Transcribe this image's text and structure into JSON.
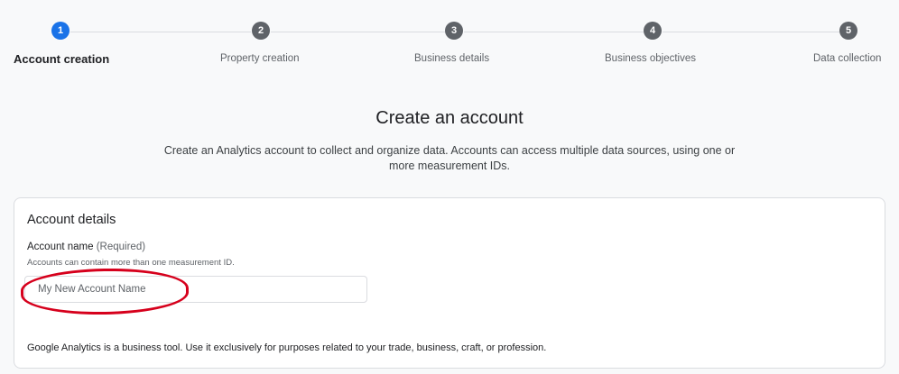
{
  "stepper": {
    "steps": [
      {
        "number": "1",
        "label": "Account creation",
        "active": true
      },
      {
        "number": "2",
        "label": "Property creation",
        "active": false
      },
      {
        "number": "3",
        "label": "Business details",
        "active": false
      },
      {
        "number": "4",
        "label": "Business objectives",
        "active": false
      },
      {
        "number": "5",
        "label": "Data collection",
        "active": false
      }
    ]
  },
  "page": {
    "title": "Create an account",
    "description": "Create an Analytics account to collect and organize data. Accounts can access multiple data sources, using one or more measurement IDs."
  },
  "account_details": {
    "title": "Account details",
    "name_label": "Account name",
    "name_required": "(Required)",
    "name_hint": "Accounts can contain more than one measurement ID.",
    "name_placeholder": "My New Account Name",
    "footnote": "Google Analytics is a business tool. Use it exclusively for purposes related to your trade, business, craft, or profession."
  },
  "colors": {
    "active_step": "#1a73e8",
    "inactive_step": "#5f6368",
    "annotation": "#d6001c"
  }
}
